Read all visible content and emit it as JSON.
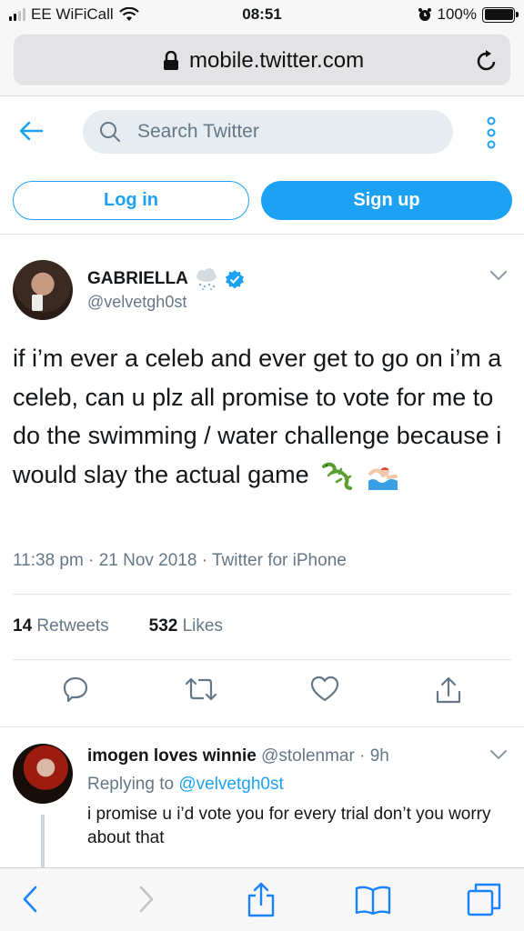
{
  "status_bar": {
    "carrier": "EE WiFiCall",
    "time": "08:51",
    "battery": "100%"
  },
  "browser": {
    "url": "mobile.twitter.com"
  },
  "header": {
    "search_placeholder": "Search Twitter",
    "login_label": "Log in",
    "signup_label": "Sign up"
  },
  "tweet": {
    "display_name": "GABRIELLA",
    "handle": "@velvetgh0st",
    "text": "if i’m ever a celeb and ever get to go on i’m a celeb, can u plz all promise to vote for me to do the swimming / water challenge because i would slay the actual game",
    "emojis": [
      "lizard",
      "swimmer"
    ],
    "timestamp": "11:38 pm · 21 Nov 2018 · Twitter for iPhone",
    "retweets_count": "14",
    "retweets_label": "Retweets",
    "likes_count": "532",
    "likes_label": "Likes",
    "action_icons": [
      "reply-icon",
      "retweet-icon",
      "like-icon",
      "share-icon"
    ],
    "accent_color": "#1da1f2"
  },
  "reply": {
    "display_name": "imogen loves winnie",
    "handle": "@stolenmar",
    "age": "· 9h",
    "replying_prefix": "Replying to",
    "replying_to": "@velvetgh0st",
    "text": "i promise u i’d vote you for every trial don’t you worry about that"
  },
  "toolbar": {
    "icons": [
      "back-icon",
      "forward-icon",
      "share-icon",
      "bookmarks-icon",
      "tabs-icon"
    ]
  }
}
